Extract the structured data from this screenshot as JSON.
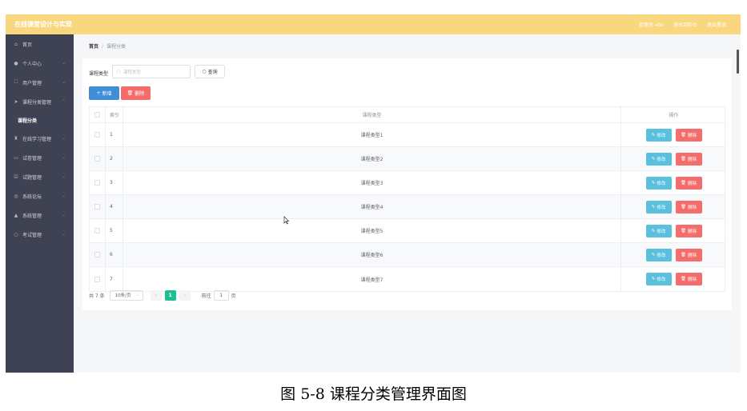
{
  "app": {
    "title": "在线课堂设计与实现",
    "user": "管理员 abo",
    "exit_system": "退出到前台",
    "logout": "退出登录"
  },
  "sidebar": {
    "items": [
      {
        "label": "首页",
        "icon": "home-icon"
      },
      {
        "label": "个人中心",
        "icon": "user-icon"
      },
      {
        "label": "用户管理",
        "icon": "users-icon"
      },
      {
        "label": "课程分类管理",
        "icon": "send-icon"
      },
      {
        "label": "课程分类",
        "icon": ""
      },
      {
        "label": "在线学习管理",
        "icon": "trophy-icon"
      },
      {
        "label": "试卷管理",
        "icon": "chat-icon"
      },
      {
        "label": "试题管理",
        "icon": "edit-icon"
      },
      {
        "label": "系统论坛",
        "icon": "forum-icon"
      },
      {
        "label": "系统管理",
        "icon": "admin-icon"
      },
      {
        "label": "考试管理",
        "icon": "exam-icon"
      }
    ]
  },
  "breadcrumb": {
    "home": "首页",
    "separator": "/",
    "current": "课程分类"
  },
  "search": {
    "label": "课程类型",
    "placeholder": "课程类型",
    "button": "查询"
  },
  "toolbar": {
    "add": "新增",
    "delete": "删除"
  },
  "table": {
    "headers": {
      "index": "索引",
      "type": "课程类型",
      "actions": "操作"
    },
    "edit_label": "修改",
    "delete_label": "删除",
    "rows": [
      {
        "index": "1",
        "type": "课程类型1"
      },
      {
        "index": "2",
        "type": "课程类型2"
      },
      {
        "index": "3",
        "type": "课程类型3"
      },
      {
        "index": "4",
        "type": "课程类型4"
      },
      {
        "index": "5",
        "type": "课程类型5"
      },
      {
        "index": "6",
        "type": "课程类型6"
      },
      {
        "index": "7",
        "type": "课程类型7"
      }
    ]
  },
  "pagination": {
    "total": "共 7 条",
    "page_size": "10条/页",
    "current_page": "1",
    "goto_prefix": "前往",
    "goto_value": "1",
    "goto_suffix": "页"
  },
  "caption": "图 5-8 课程分类管理界面图",
  "colors": {
    "header": "#f9d77e",
    "sidebar": "#3f4252",
    "primary": "#3f8ed8",
    "danger": "#f56c6c",
    "edit": "#5bc0de",
    "page_active": "#1dbf91"
  }
}
